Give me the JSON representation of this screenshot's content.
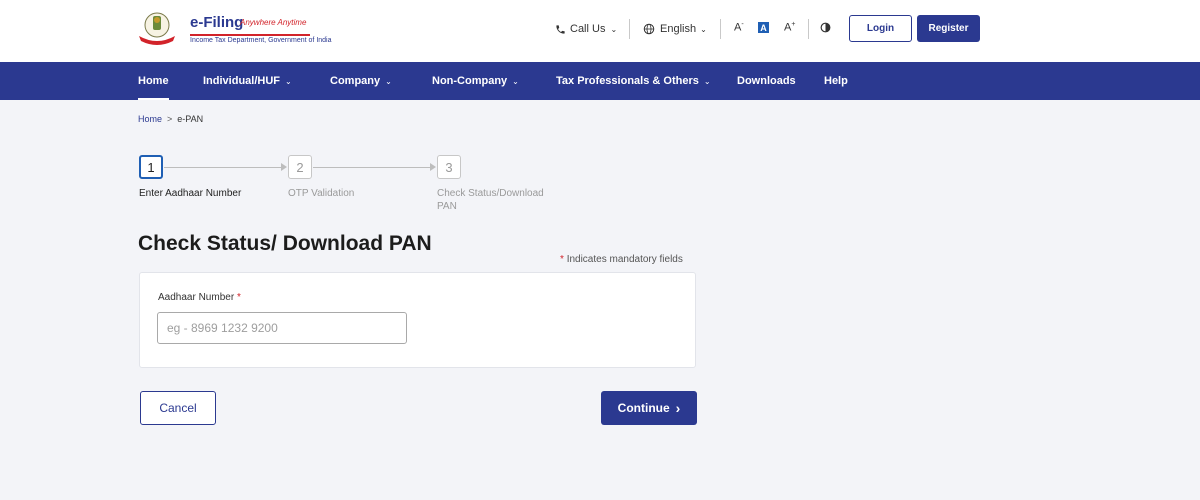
{
  "header": {
    "logo": {
      "title": "e-Filing",
      "tagline": "Anywhere Anytime",
      "subtitle": "Income Tax Department, Government of India"
    },
    "call_us": "Call Us",
    "language": "English",
    "font_decrease": "A",
    "font_normal": "A",
    "font_increase": "A",
    "login": "Login",
    "register": "Register"
  },
  "nav": {
    "items": [
      {
        "label": "Home",
        "has_caret": false,
        "active": true
      },
      {
        "label": "Individual/HUF",
        "has_caret": true
      },
      {
        "label": "Company",
        "has_caret": true
      },
      {
        "label": "Non-Company",
        "has_caret": true
      },
      {
        "label": "Tax Professionals & Others",
        "has_caret": true
      },
      {
        "label": "Downloads",
        "has_caret": false
      },
      {
        "label": "Help",
        "has_caret": false
      }
    ]
  },
  "breadcrumb": {
    "home": "Home",
    "separator": ">",
    "current": "e-PAN"
  },
  "stepper": {
    "steps": [
      {
        "number": "1",
        "label": "Enter Aadhaar Number",
        "active": true
      },
      {
        "number": "2",
        "label": "OTP Validation",
        "active": false
      },
      {
        "number": "3",
        "label_line1": "Check Status/Download",
        "label_line2": "PAN",
        "active": false
      }
    ]
  },
  "form": {
    "title": "Check Status/ Download PAN",
    "mandatory_star": "*",
    "mandatory_note": "Indicates mandatory fields",
    "aadhaar_label": "Aadhaar Number",
    "aadhaar_required": "*",
    "aadhaar_placeholder": "eg - 8969 1232 9200",
    "aadhaar_value": ""
  },
  "actions": {
    "cancel": "Cancel",
    "continue": "Continue",
    "continue_chevron": "›"
  },
  "colors": {
    "primary": "#2b3990",
    "accent_blue": "#1f5fb4",
    "required_red": "#d2232a",
    "page_background": "#f3f4f8"
  },
  "icons": {
    "phone": "phone-icon",
    "globe": "globe-icon",
    "contrast": "contrast-icon",
    "emblem": "emblem-icon"
  }
}
